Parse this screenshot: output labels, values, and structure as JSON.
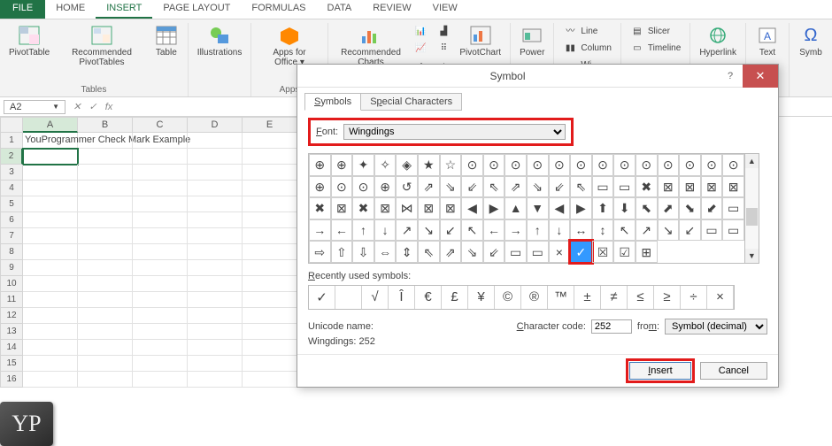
{
  "menu": {
    "file": "FILE",
    "tabs": [
      "HOME",
      "INSERT",
      "PAGE LAYOUT",
      "FORMULAS",
      "DATA",
      "REVIEW",
      "VIEW"
    ],
    "active_index": 1
  },
  "ribbon": {
    "groups": {
      "tables": {
        "label": "Tables",
        "pivottable": "PivotTable",
        "recommended": "Recommended PivotTables",
        "table": "Table"
      },
      "illus": {
        "label": "",
        "btn": "Illustrations"
      },
      "apps": {
        "label": "Apps",
        "btn": "Apps for Office ▾"
      },
      "charts": {
        "label": "",
        "recommended": "Recommended Charts",
        "pivotchart": "PivotChart"
      },
      "power": {
        "label": "",
        "btn": "Power"
      },
      "sparklines": {
        "line": "Line",
        "column": "Column",
        "wl": "Wi"
      },
      "filters": {
        "slicer": "Slicer",
        "timeline": "Timeline"
      },
      "links": {
        "hyperlink": "Hyperlink"
      },
      "text": {
        "btn": "Text"
      },
      "symbols": {
        "btn": "Symb"
      }
    }
  },
  "namebox": "A2",
  "cells": {
    "a1": "YouProgrammer Check Mark Example"
  },
  "columns": [
    "A",
    "B",
    "C",
    "D",
    "E"
  ],
  "rows": [
    1,
    2,
    3,
    4,
    5,
    6,
    7,
    8,
    9,
    10,
    11,
    12,
    13,
    14,
    15,
    16
  ],
  "dialog": {
    "title": "Symbol",
    "tabs": {
      "symbols": "Symbols",
      "special": "Special Characters"
    },
    "font_label": "Font:",
    "font_value": "Wingdings",
    "grid": [
      [
        "⊕",
        "⊕",
        "✦",
        "✧",
        "◈",
        "★",
        "☆",
        "⊙",
        "⊙",
        "⊙",
        "⊙",
        "⊙",
        "⊙",
        "⊙",
        "⊙",
        "⊙",
        "⊙",
        "⊙",
        "⊙",
        "⊙"
      ],
      [
        "⊕",
        "⊙",
        "⊙",
        "⊕",
        "↺",
        "⇗",
        "⇘",
        "⇙",
        "⇖",
        "⇗",
        "⇘",
        "⇙",
        "⇖",
        "▭",
        "▭",
        "✖",
        "⊠",
        "⊠",
        "⊠",
        "⊠"
      ],
      [
        "✖",
        "⊠",
        "✖",
        "⊠",
        "⋈",
        "⊠",
        "⊠",
        "◀",
        "▶",
        "▲",
        "▼",
        "◀",
        "▶",
        "⬆",
        "⬇",
        "⬉",
        "⬈",
        "⬊",
        "⬋",
        "▭"
      ],
      [
        "→",
        "←",
        "↑",
        "↓",
        "↗",
        "↘",
        "↙",
        "↖",
        "←",
        "→",
        "↑",
        "↓",
        "↔",
        "↕",
        "↖",
        "↗",
        "↘",
        "↙",
        "▭",
        "▭"
      ],
      [
        "⇨",
        "⇧",
        "⇩",
        "⇔",
        "⇕",
        "⇖",
        "⇗",
        "⇘",
        "⇙",
        "▭",
        "▭",
        "×",
        "✓",
        "☒",
        "☑",
        "⊞",
        "",
        "",
        "",
        ""
      ]
    ],
    "selected": {
      "row": 4,
      "col": 12
    },
    "recent_label": "Recently used symbols:",
    "recent": [
      "✓",
      "",
      "√",
      "Î",
      "€",
      "£",
      "¥",
      "©",
      "®",
      "™",
      "±",
      "≠",
      "≤",
      "≥",
      "÷",
      "×"
    ],
    "uniname_label": "Unicode name:",
    "uniname_value": "Wingdings: 252",
    "code_label": "Character code:",
    "code_value": "252",
    "from_label": "from:",
    "from_value": "Symbol (decimal)",
    "insert": "Insert",
    "cancel": "Cancel"
  },
  "logo": "YP"
}
